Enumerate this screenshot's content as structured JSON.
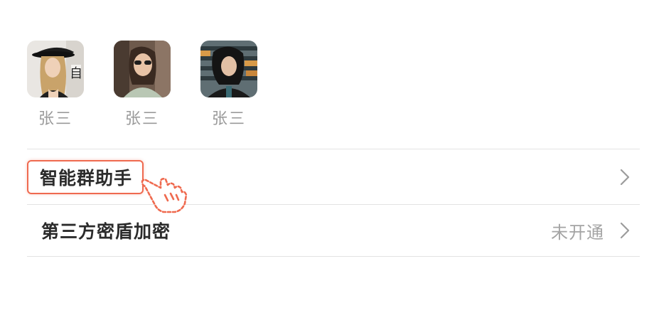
{
  "members": [
    {
      "name": "张三"
    },
    {
      "name": "张三"
    },
    {
      "name": "张三"
    }
  ],
  "settings": {
    "assistant": {
      "label": "智能群助手"
    },
    "encryption": {
      "label": "第三方密盾加密",
      "value": "未开通"
    }
  },
  "colors": {
    "highlight": "#ef6a4f",
    "label": "#2b2b2b",
    "muted": "#9a9a9a",
    "divider": "#e3e3e3"
  },
  "icons": [
    "chevron-right-icon",
    "pointer-hand-icon"
  ]
}
